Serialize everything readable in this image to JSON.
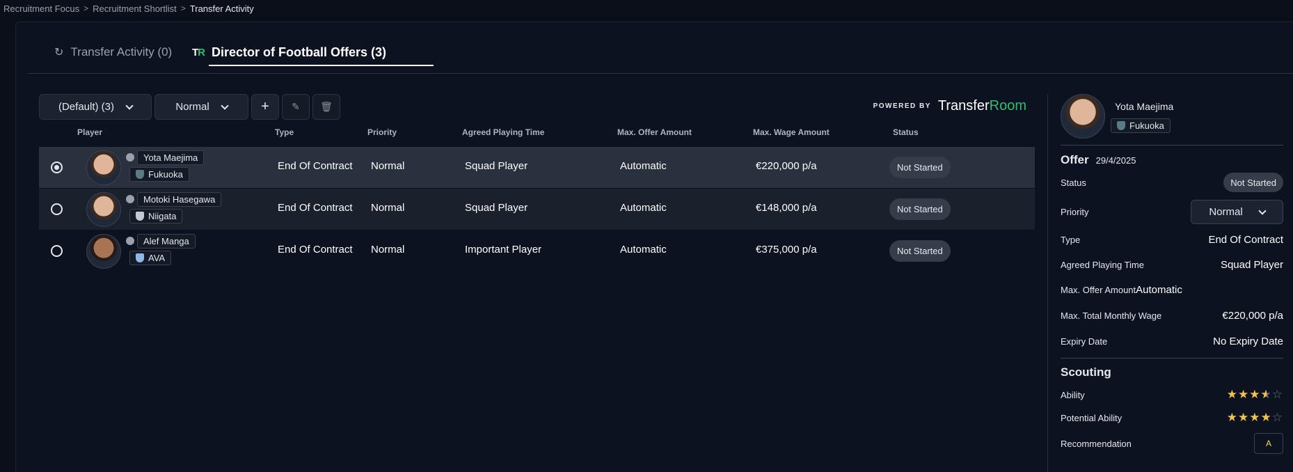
{
  "breadcrumb": {
    "items": [
      "Recruitment Focus",
      "Recruitment Shortlist",
      "Transfer Activity"
    ]
  },
  "tabs": [
    {
      "label": "Transfer Activity (0)"
    },
    {
      "label": "Director of Football Offers (3)",
      "logo_t": "T",
      "logo_r": "R"
    }
  ],
  "toolbar": {
    "view_select": "(Default) (3)",
    "priority_select": "Normal",
    "add_label": "+",
    "edit_label": "✎",
    "delete_label": "🗑"
  },
  "powered": {
    "prefix": "POWERED BY",
    "brand_a": "Transfer",
    "brand_b": "Room"
  },
  "table": {
    "headers": [
      "Player",
      "Type",
      "Priority",
      "Agreed Playing Time",
      "Max. Offer Amount",
      "Max. Wage Amount",
      "Status"
    ],
    "rows": [
      {
        "name": "Yota Maejima",
        "club": "Fukuoka",
        "type": "End Of Contract",
        "priority": "Normal",
        "playing_time": "Squad Player",
        "offer": "Automatic",
        "wage": "€220,000 p/a",
        "status": "Not Started",
        "selected": true
      },
      {
        "name": "Motoki Hasegawa",
        "club": "Niigata",
        "type": "End Of Contract",
        "priority": "Normal",
        "playing_time": "Squad Player",
        "offer": "Automatic",
        "wage": "€148,000 p/a",
        "status": "Not Started",
        "selected": false
      },
      {
        "name": "Alef Manga",
        "club": "AVA",
        "type": "End Of Contract",
        "priority": "Normal",
        "playing_time": "Important Player",
        "offer": "Automatic",
        "wage": "€375,000 p/a",
        "status": "Not Started",
        "selected": false
      }
    ]
  },
  "side": {
    "name": "Yota Maejima",
    "club": "Fukuoka",
    "offer_title": "Offer",
    "offer_date": "29/4/2025",
    "status_label": "Status",
    "status_value": "Not Started",
    "priority_label": "Priority",
    "priority_value": "Normal",
    "type_label": "Type",
    "type_value": "End Of Contract",
    "playing_time_label": "Agreed Playing Time",
    "playing_time_value": "Squad Player",
    "max_offer_label": "Max. Offer Amount",
    "max_offer_value": "Automatic",
    "wage_label": "Max. Total Monthly Wage",
    "wage_value": "€220,000 p/a",
    "expiry_label": "Expiry Date",
    "expiry_value": "No Expiry Date",
    "scouting_title": "Scouting",
    "ability_label": "Ability",
    "ability_stars": 3.5,
    "potential_label": "Potential Ability",
    "potential_stars": 4,
    "recommendation_label": "Recommendation",
    "recommendation_value": "A"
  }
}
